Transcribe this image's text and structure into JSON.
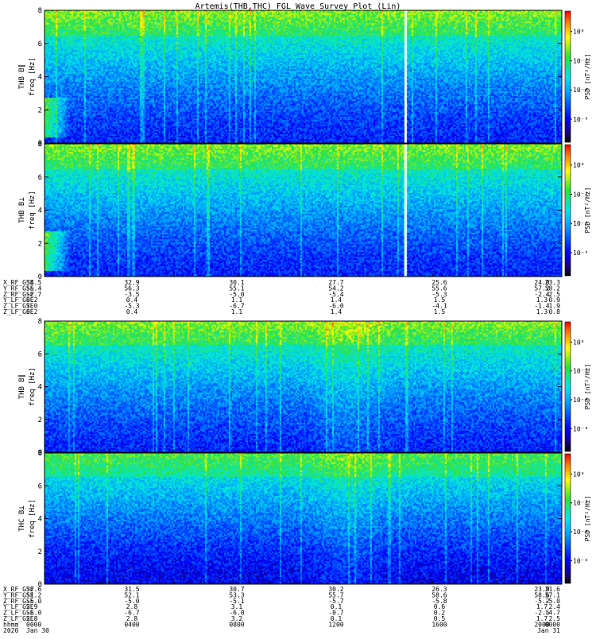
{
  "title": "Artemis(THB,THC) FGL Wave Survey Plot (Lin)",
  "colorbar_ticks": [
    "10⁰",
    "10⁻²",
    "10⁻⁴",
    "10⁻⁶"
  ],
  "colorbar_unit": "PSD [nT²/Hz]",
  "ephem1": {
    "labels": [
      "X_RF_GSE",
      "Y_RF_GSE",
      "Z_RF_GSE",
      "Y_LF_GSE",
      "Z_LF_GSE",
      "Z_LF_GSE"
    ],
    "cols": [
      [
        "34.5",
        "55.4",
        "-2.7",
        "0.2",
        "7.0",
        "0.2"
      ],
      [
        "32.9",
        "56.3",
        "-3.5",
        "0.4",
        "-5.3",
        "0.4"
      ],
      [
        "30.1",
        "55.1",
        "-5.0",
        "1.1",
        "-6.7",
        "1.1"
      ],
      [
        "27.7",
        "54.2",
        "-5.4",
        "1.4",
        "-6.0",
        "1.4"
      ],
      [
        "25.6",
        "55.6",
        "-5.3",
        "1.5",
        "-4.1",
        "1.5"
      ],
      [
        "24.0",
        "57.2",
        "-2.4",
        "1.3",
        "-1.4",
        "1.3"
      ],
      [
        "23.3",
        "58.2",
        "-2.5",
        "0.9",
        "1.9",
        "0.8"
      ]
    ]
  },
  "ephem2": {
    "labels": [
      "X_RF_GSE",
      "Y_RF_GSE",
      "Z_RF_GSE",
      "Y_LF_GSE",
      "Z_LF_GSE",
      "Z_LF_GSE",
      "hhmm",
      "2020"
    ],
    "cols": [
      [
        "32.6",
        "51.2",
        "-5.0",
        "2.9",
        "-6.0",
        "2.8",
        "0000",
        "Jan 30"
      ],
      [
        "31.5",
        "52.1",
        "-5.0",
        "2.8",
        "-6.7",
        "2.8",
        "0400",
        ""
      ],
      [
        "30.7",
        "53.3",
        "-5.1",
        "3.1",
        "-6.0",
        "3.2",
        "0800",
        ""
      ],
      [
        "30.2",
        "55.7",
        "-5.7",
        "0.1",
        "-0.7",
        "0.1",
        "1200",
        ""
      ],
      [
        "26.3",
        "58.6",
        "-5.8",
        "0.6",
        "0.2",
        "0.5",
        "1600",
        ""
      ],
      [
        "23.9",
        "58.6",
        "-5.2",
        "1.7",
        "-2.5",
        "1.7",
        "2000",
        ""
      ],
      [
        "21.6",
        "57.1",
        "-5.0",
        "2.4",
        "-4.7",
        "2.5",
        "0000",
        "Jan 31"
      ]
    ]
  },
  "chart_data": [
    {
      "type": "heatmap",
      "panel": "THB B∥",
      "ylabel": "THB B∥",
      "yunit": "freq [Hz]",
      "ylim": [
        0,
        8
      ],
      "yticks": [
        "0",
        "2",
        "4",
        "6",
        "8"
      ],
      "zscale": "log",
      "zlim": [
        "10⁻⁷",
        "10¹"
      ],
      "data_gap": true
    },
    {
      "type": "heatmap",
      "panel": "THB B⊥",
      "ylabel": "THB B⊥",
      "yunit": "freq [Hz]",
      "ylim": [
        0,
        8
      ],
      "yticks": [
        "0",
        "2",
        "4",
        "6",
        "8"
      ],
      "zscale": "log",
      "zlim": [
        "10⁻⁷",
        "10¹"
      ],
      "data_gap": true
    },
    {
      "type": "heatmap",
      "panel": "THB B∥ (THC)",
      "ylabel": "THB B∥",
      "yunit": "freq [Hz]",
      "ylim": [
        0,
        8
      ],
      "yticks": [
        "0",
        "2",
        "4",
        "6",
        "8"
      ],
      "zscale": "log",
      "zlim": [
        "10⁻⁷",
        "10¹"
      ]
    },
    {
      "type": "heatmap",
      "panel": "THC B⊥",
      "ylabel": "THC B⊥",
      "yunit": "freq [Hz]",
      "ylim": [
        0,
        8
      ],
      "yticks": [
        "0",
        "2",
        "4",
        "6",
        "8"
      ],
      "zscale": "log",
      "zlim": [
        "10⁻⁷",
        "10¹"
      ]
    }
  ]
}
